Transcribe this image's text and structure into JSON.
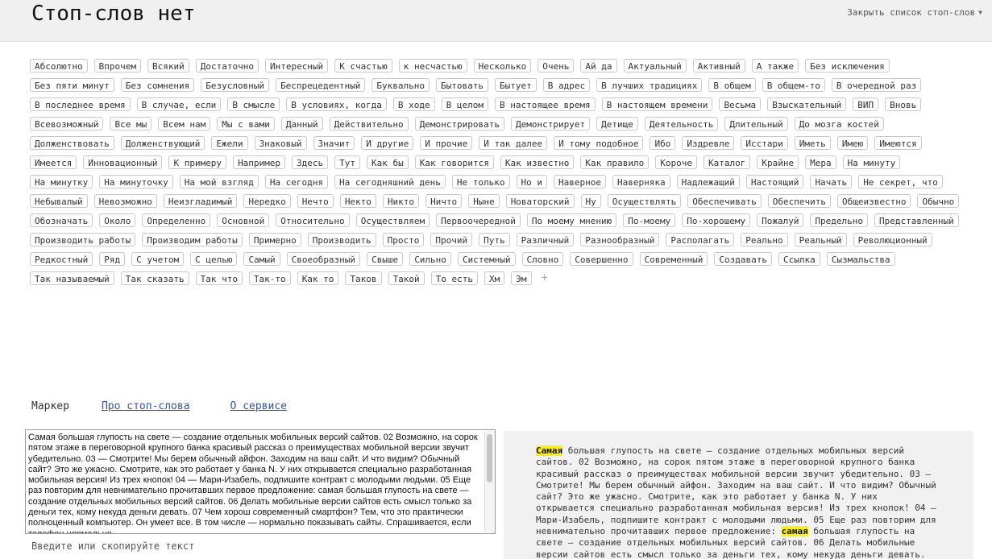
{
  "header": {
    "title": "Стоп-слов нет",
    "close_label": "Закрыть список стоп-слов",
    "close_icon": "triangle-down-icon"
  },
  "stop_words": [
    "Абсолютно",
    "Впрочем",
    "Всякий",
    "Достаточно",
    "Интересный",
    "К счастью",
    "к несчастью",
    "Несколько",
    "Очень",
    "Ай да",
    "Актуальный",
    "Активный",
    "А также",
    "Без исключения",
    "Без пяти минут",
    "Без сомнения",
    "Безусловный",
    "Беспрецедентный",
    "Буквально",
    "Бытовать",
    "Бытует",
    "В адрес",
    "В лучших традициях",
    "В общем",
    "В общем-то",
    "В очередной раз",
    "В последнее время",
    "В случае, если",
    "В смысле",
    "В условиях, когда",
    "В ходе",
    "В целом",
    "В настоящее время",
    "В настоящем времени",
    "Весьма",
    "Взыскательный",
    "ВИП",
    "Вновь",
    "Всевозможный",
    "Все мы",
    "Всем нам",
    "Мы с вами",
    "Данный",
    "Действительно",
    "Демонстрировать",
    "Демонстрирует",
    "Детище",
    "Деятельность",
    "Длительный",
    "До мозга костей",
    "Долженствовать",
    "Долженствующий",
    "Ежели",
    "Знаковый",
    "Значит",
    "И другие",
    "И прочие",
    "И так далее",
    "И тому подобное",
    "Ибо",
    "Издревле",
    "Исстари",
    "Иметь",
    "Имею",
    "Имеются",
    "Имеется",
    "Инновационный",
    "К примеру",
    "Например",
    "Здесь",
    "Тут",
    "Как бы",
    "Как говорится",
    "Как известно",
    "Как правило",
    "Короче",
    "Каталог",
    "Крайне",
    "Мера",
    "На минуту",
    "На минутку",
    "На минуточку",
    "На мой взгляд",
    "На сегодня",
    "На сегодняшний день",
    "Не только",
    "Но и",
    "Наверное",
    "Наверняка",
    "Надлежащий",
    "Настоящий",
    "Начать",
    "Не секрет, что",
    "Небывалый",
    "Невозможно",
    "Неизгладимый",
    "Нередко",
    "Нечто",
    "Некто",
    "Никто",
    "Ничто",
    "Ныне",
    "Новаторский",
    "Ну",
    "Осуществлять",
    "Обеспечивать",
    "Обеспечить",
    "Общеизвестно",
    "Обычно",
    "Обозначать",
    "Около",
    "Определенно",
    "Основной",
    "Относительно",
    "Осуществляем",
    "Первоочередной",
    "По моему мнению",
    "По-моему",
    "По-хорошему",
    "Пожалуй",
    "Предельно",
    "Представленный",
    "Производить работы",
    "Производим работы",
    "Примерно",
    "Производить",
    "Просто",
    "Прочий",
    "Путь",
    "Различный",
    "Разнообразный",
    "Располагать",
    "Реально",
    "Реальный",
    "Революционный",
    "Редкостный",
    "Ряд",
    "С учетом",
    "С целью",
    "Самый",
    "Своеобразный",
    "Свыше",
    "Сильно",
    "Системный",
    "Словно",
    "Совершенно",
    "Современный",
    "Создавать",
    "Ссылка",
    "Сызмальства",
    "Так называемый",
    "Так сказать",
    "Так что",
    "Так-то",
    "Как то",
    "Таков",
    "Такой",
    "То есть",
    "Хм",
    "Эм"
  ],
  "add_word_label": "+",
  "nav": {
    "label": "Маркер",
    "link_about_words": "Про стоп-слова",
    "link_about_service": "О сервисе"
  },
  "input": {
    "text": "Самая большая глупость на свете — создание отдельных мобильных версий сайтов. 02 Возможно, на сорок пятом этаже в переговорной крупного банка красивый рассказ о преимуществах мобильной версии звучит убедительно. 03 — Смотрите! Мы берем обычный айфон. Заходим на ваш сайт. И что видим? Обычный сайт? Это же ужасно. Смотрите, как это работает у банка N. У них открывается специально разработанная мобильная версия! Из трех кнопок! 04 — Мари-Изабель, подпишите контракт с молодыми людьми. 05 Еще раз повторим для невнимательно прочитавших первое предложение: самая большая глупость на свете — создание отдельных мобильных версий сайтов. 06 Делать мобильные версии сайтов есть смысл только за деньги тех, кому некуда деньги девать. 07 Чем хорош современный смартфон? Тем, что это практически полноценный компьютер. Он умеет все. В том числе — нормально показывать сайты. Спрашивается, если телефон нормально",
    "placeholder": "Введите или скопируйте текст"
  },
  "output": {
    "highlight_1": "Самая",
    "part_1": " большая глупость на свете — создание отдельных мобильных версий сайтов. 02 Возможно, на сорок пятом этаже в переговорной крупного банка красивый рассказ о преимуществах мобильной версии звучит убедительно. 03 — Смотрите! Мы берем обычный айфон. Заходим на ваш сайт. И что видим? Обычный сайт? Это же ужасно. Смотрите, как это работает у банка N. У них открывается специально разработанная мобильная версия! Из трех кнопок! 04 — Мари-Изабель, подпишите контракт с молодыми людьми. 05 Еще раз повторим для невнимательно прочитавших первое предложение: ",
    "highlight_2": "самая",
    "part_2": " большая глупость на свете — создание отдельных мобильных версий сайтов. 06 Делать мобильные версии сайтов есть смысл только за деньги тех, кому некуда деньги девать.",
    "highlight_color": "#fff200"
  }
}
